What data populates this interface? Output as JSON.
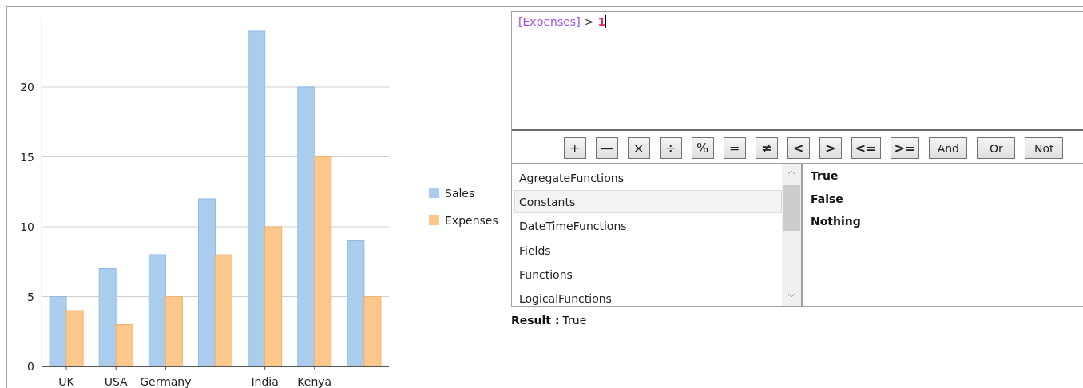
{
  "chart": {
    "chart_data": {
      "type": "bar",
      "categories": [
        "UK",
        "USA",
        "Germany",
        null,
        "India",
        "Kenya",
        null
      ],
      "series": [
        {
          "name": "Sales",
          "color": "#aacdee",
          "values": [
            5,
            7,
            8,
            12,
            24,
            20,
            9
          ]
        },
        {
          "name": "Expenses",
          "color": "#fcc78a",
          "values": [
            4,
            3,
            5,
            8,
            10,
            15,
            5
          ]
        }
      ],
      "ylim": [
        0,
        25
      ],
      "yticks": [
        0,
        5,
        10,
        15,
        20
      ],
      "grid": true,
      "legend": true
    }
  },
  "expression": [
    {
      "kind": "field",
      "text": "[Expenses]"
    },
    {
      "kind": "operator",
      "text": ">"
    },
    {
      "kind": "number",
      "text": "1"
    }
  ],
  "operators": [
    {
      "kind": "symbol",
      "label": "+"
    },
    {
      "kind": "symbol",
      "label": "—"
    },
    {
      "kind": "symbol",
      "label": "×"
    },
    {
      "kind": "symbol",
      "label": "÷"
    },
    {
      "kind": "symbol",
      "label": "%"
    },
    {
      "kind": "symbol",
      "label": "="
    },
    {
      "kind": "bold",
      "label": "≠"
    },
    {
      "kind": "bold",
      "label": "<"
    },
    {
      "kind": "bold",
      "label": ">"
    },
    {
      "kind": "bold",
      "label": "<="
    },
    {
      "kind": "bold",
      "label": ">="
    },
    {
      "kind": "word",
      "label": "And"
    },
    {
      "kind": "word",
      "label": "Or"
    },
    {
      "kind": "word",
      "label": "Not"
    }
  ],
  "categories": [
    {
      "label": "AgregateFunctions",
      "selected": false
    },
    {
      "label": "Constants",
      "selected": true
    },
    {
      "label": "DateTimeFunctions",
      "selected": false
    },
    {
      "label": "Fields",
      "selected": false
    },
    {
      "label": "Functions",
      "selected": false
    },
    {
      "label": "LogicalFunctions",
      "selected": false
    }
  ],
  "items": [
    "True",
    "False",
    "Nothing"
  ],
  "result": {
    "label": "Result :",
    "value": "True"
  }
}
